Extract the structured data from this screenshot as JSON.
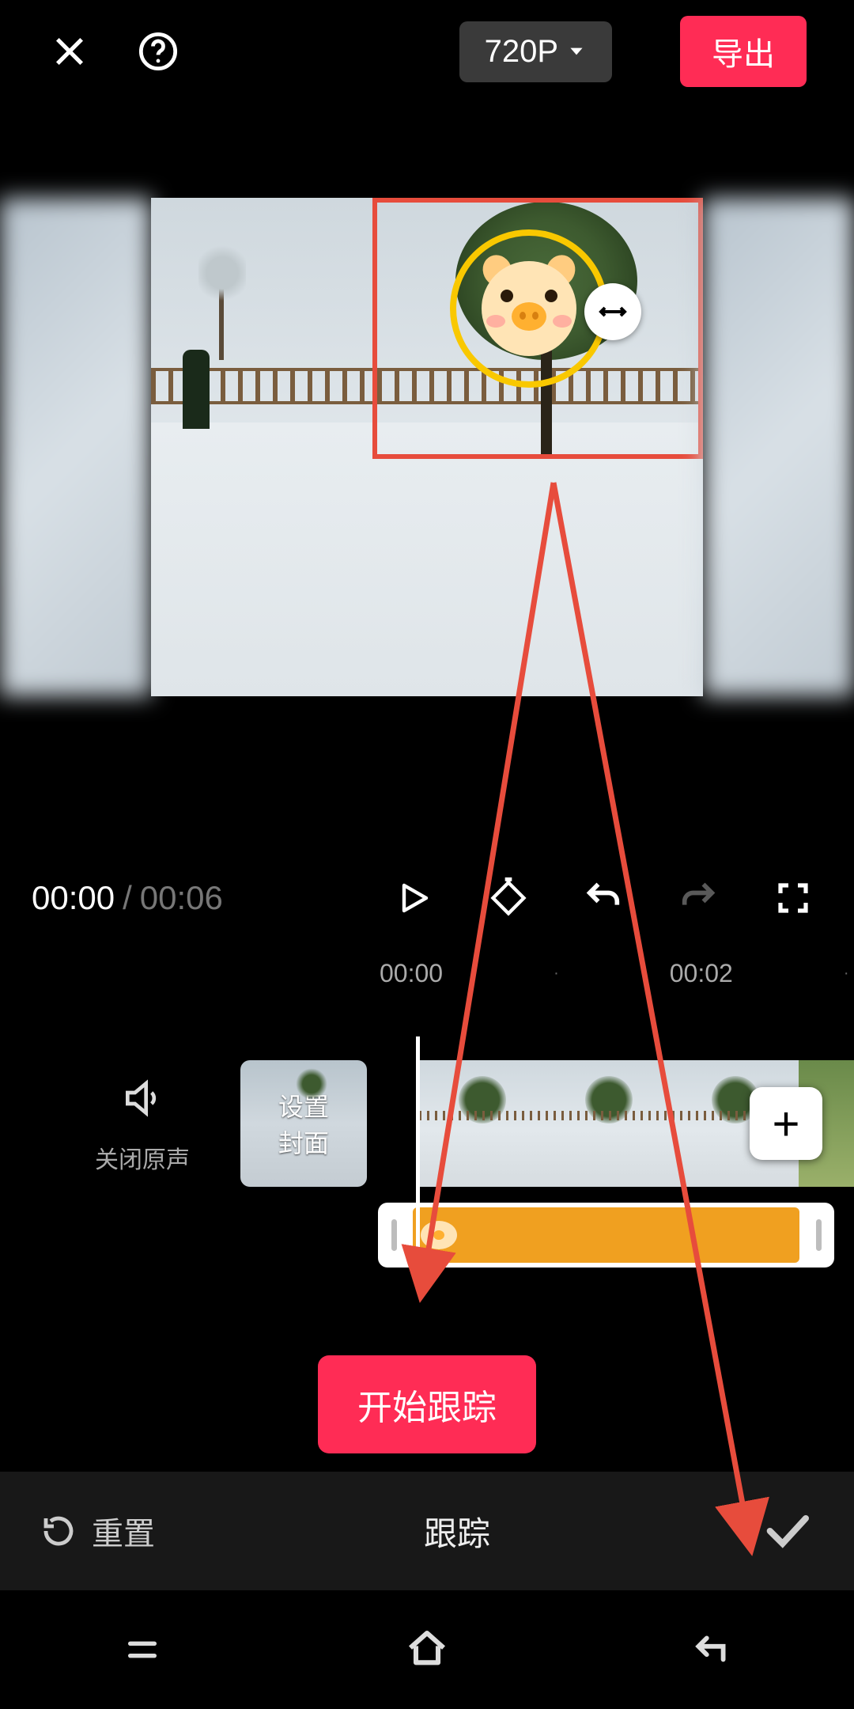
{
  "header": {
    "resolution_label": "720P",
    "export_label": "导出"
  },
  "playback": {
    "current_time": "00:00",
    "separator": "/",
    "total_time": "00:06"
  },
  "ruler": {
    "t0": "00:00",
    "dot": "·",
    "t1": "00:02"
  },
  "timeline": {
    "mute_label": "关闭原声",
    "cover_label_line1": "设置",
    "cover_label_line2": "封面",
    "add_label": "+"
  },
  "action": {
    "start_tracking": "开始跟踪"
  },
  "bottom": {
    "reset_label": "重置",
    "title": "跟踪"
  },
  "icons": {
    "close": "close",
    "help": "help",
    "chevron_down": "chevron-down",
    "play": "play",
    "keyframe": "keyframe",
    "undo": "undo",
    "redo": "redo",
    "fullscreen": "fullscreen",
    "speaker": "speaker",
    "reset": "reset",
    "check": "check",
    "resize": "resize-h"
  },
  "colors": {
    "accent": "#ff2c55",
    "selection": "#e74c3c",
    "sticker_ring": "#f9c800",
    "sticker_track": "#f0a020"
  }
}
